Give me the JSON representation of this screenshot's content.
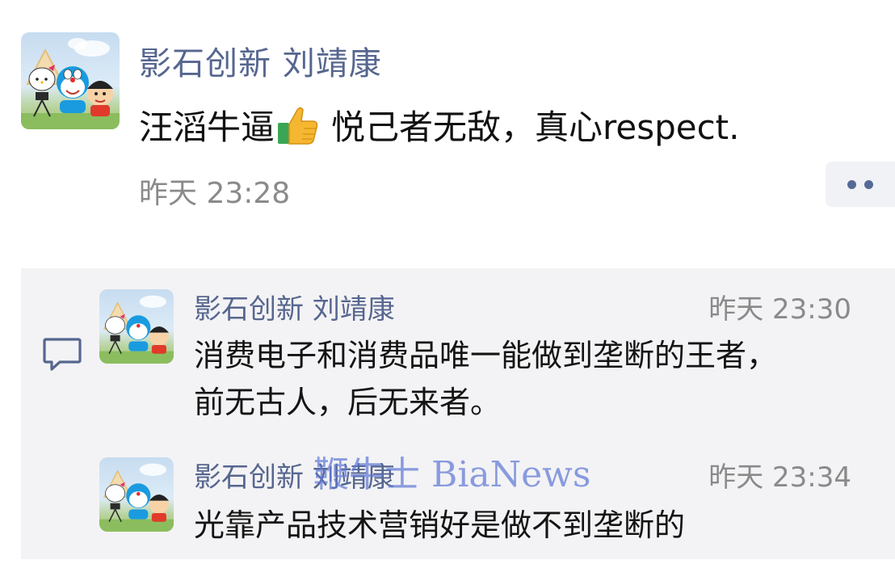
{
  "post": {
    "author": "影石创新 刘靖康",
    "text_before_emoji": "汪滔牛逼",
    "emoji": "thumbs-up-icon",
    "text_after_emoji": "悦己者无敌，真心respect.",
    "time": "昨天 23:28",
    "more_icon": "more-dots-icon"
  },
  "comments": [
    {
      "author": "影石创新 刘靖康",
      "time": "昨天 23:30",
      "lines": [
        "消费电子和消费品唯一能做到垄断的王者，",
        "前无古人，后无来者。"
      ]
    },
    {
      "author": "影石创新 刘靖康",
      "time": "昨天 23:34",
      "lines": [
        "光靠产品技术营销好是做不到垄断的"
      ]
    }
  ],
  "comment_icon": "comment-bubble-icon",
  "watermark": "鞭牛士 BiaNews",
  "colors": {
    "name": "#56668f",
    "time": "#8a8a8a",
    "panel": "#f3f3f5",
    "watermark": "#6078d6"
  }
}
